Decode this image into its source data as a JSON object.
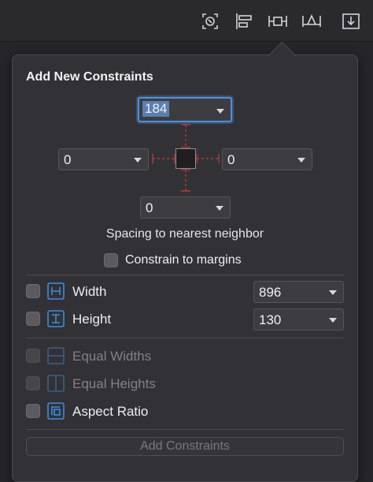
{
  "toolbar": {
    "icons": [
      "resolve-issues-icon",
      "align-icon",
      "add-constraints-icon",
      "resolve-auto-layout-icon",
      "embed-in-icon"
    ]
  },
  "popover": {
    "title": "Add New Constraints",
    "top_value": "184",
    "left_value": "0",
    "right_value": "0",
    "bottom_value": "0",
    "spacing_label": "Spacing to nearest neighbor",
    "margins_label": "Constrain to margins",
    "width_label": "Width",
    "width_value": "896",
    "height_label": "Height",
    "height_value": "130",
    "equal_widths_label": "Equal Widths",
    "equal_heights_label": "Equal Heights",
    "aspect_ratio_label": "Aspect Ratio",
    "add_button_label": "Add Constraints"
  },
  "colors": {
    "accent": "#4a90e2",
    "strut": "#b83a3a",
    "icon_blue": "#3c8dde"
  }
}
